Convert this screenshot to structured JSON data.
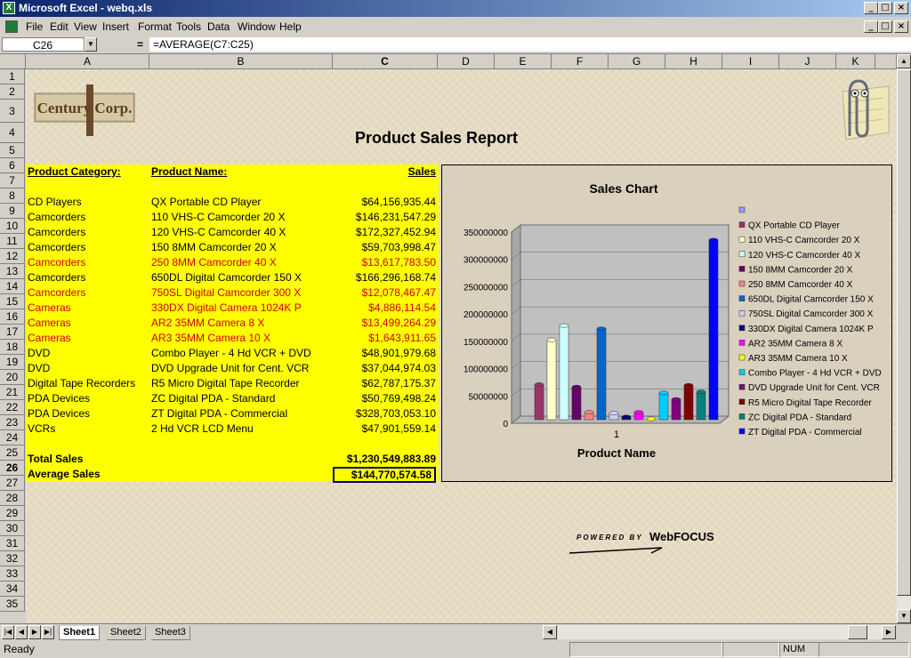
{
  "window": {
    "title": "Microsoft Excel - webq.xls",
    "app_icon": "excel-icon"
  },
  "menu": [
    "File",
    "Edit",
    "View",
    "Insert",
    "Format",
    "Tools",
    "Data",
    "Window",
    "Help"
  ],
  "formula_bar": {
    "name_box": "C26",
    "equals": "=",
    "formula": "=AVERAGE(C7:C25)"
  },
  "columns": [
    "A",
    "B",
    "C",
    "D",
    "E",
    "F",
    "G",
    "H",
    "I",
    "J",
    "K"
  ],
  "rows": [
    "1",
    "2",
    "3",
    "4",
    "5",
    "6",
    "7",
    "8",
    "9",
    "10",
    "11",
    "12",
    "13",
    "14",
    "15",
    "16",
    "17",
    "18",
    "19",
    "20",
    "21",
    "22",
    "23",
    "24",
    "25",
    "26",
    "27",
    "28",
    "29",
    "30",
    "31",
    "32",
    "33",
    "34",
    "35"
  ],
  "report": {
    "logo_text": "Century Corp.",
    "title": "Product Sales Report",
    "headers": {
      "category": "Product Category:",
      "name": "Product Name:",
      "sales": "Sales"
    },
    "items": [
      {
        "category": "CD Players",
        "name": "QX Portable CD Player",
        "sales": "$64,156,935.44",
        "red": false
      },
      {
        "category": "Camcorders",
        "name": "110 VHS-C Camcorder 20 X",
        "sales": "$146,231,547.29",
        "red": false
      },
      {
        "category": "Camcorders",
        "name": "120 VHS-C Camcorder 40 X",
        "sales": "$172,327,452.94",
        "red": false
      },
      {
        "category": "Camcorders",
        "name": "150 8MM Camcorder 20 X",
        "sales": "$59,703,998.47",
        "red": false
      },
      {
        "category": "Camcorders",
        "name": "250 8MM Camcorder 40 X",
        "sales": "$13,617,783.50",
        "red": true
      },
      {
        "category": "Camcorders",
        "name": "650DL Digital Camcorder 150 X",
        "sales": "$166,296,168.74",
        "red": false
      },
      {
        "category": "Camcorders",
        "name": "750SL Digital Camcorder 300 X",
        "sales": "$12,078,467.47",
        "red": true
      },
      {
        "category": "Cameras",
        "name": "330DX Digital Camera 1024K P",
        "sales": "$4,886,114.54",
        "red": true
      },
      {
        "category": "Cameras",
        "name": "AR2 35MM Camera 8 X",
        "sales": "$13,499,264.29",
        "red": true
      },
      {
        "category": "Cameras",
        "name": "AR3 35MM Camera 10 X",
        "sales": "$1,643,911.65",
        "red": true
      },
      {
        "category": "DVD",
        "name": "Combo Player - 4 Hd VCR + DVD",
        "sales": "$48,901,979.68",
        "red": false
      },
      {
        "category": "DVD",
        "name": "DVD Upgrade Unit for Cent. VCR",
        "sales": "$37,044,974.03",
        "red": false
      },
      {
        "category": "Digital Tape Recorders",
        "name": "R5 Micro Digital Tape Recorder",
        "sales": "$62,787,175.37",
        "red": false
      },
      {
        "category": "PDA Devices",
        "name": "ZC Digital PDA - Standard",
        "sales": "$50,769,498.24",
        "red": false
      },
      {
        "category": "PDA Devices",
        "name": "ZT Digital PDA - Commercial",
        "sales": "$328,703,053.10",
        "red": false
      },
      {
        "category": "VCRs",
        "name": "2 Hd VCR LCD Menu",
        "sales": "$47,901,559.14",
        "red": false
      }
    ],
    "total_label": "Total Sales",
    "total_value": "$1,230,549,883.89",
    "avg_label": "Average Sales",
    "avg_value": "$144,770,574.58",
    "powered_by": "POWERED BY",
    "powered_brand": "WebFOCUS"
  },
  "chart_data": {
    "type": "bar",
    "title": "Sales Chart",
    "xlabel": "Product Name",
    "categories": [
      "1"
    ],
    "ylim": [
      0,
      350000000
    ],
    "yticks": [
      "0",
      "50000000",
      "100000000",
      "150000000",
      "200000000",
      "250000000",
      "300000000",
      "350000000"
    ],
    "series": [
      {
        "name": "",
        "value": 0,
        "color": "#9999ff"
      },
      {
        "name": "QX Portable CD Player",
        "value": 64156935,
        "color": "#993366"
      },
      {
        "name": "110 VHS-C Camcorder 20 X",
        "value": 146231547,
        "color": "#ffffcc"
      },
      {
        "name": "120 VHS-C Camcorder 40 X",
        "value": 172327453,
        "color": "#ccffff"
      },
      {
        "name": "150 8MM Camcorder 20 X",
        "value": 59703998,
        "color": "#660066"
      },
      {
        "name": "250 8MM Camcorder 40 X",
        "value": 13617784,
        "color": "#ff8080"
      },
      {
        "name": "650DL Digital Camcorder 150 X",
        "value": 166296169,
        "color": "#0066cc"
      },
      {
        "name": "750SL Digital Camcorder 300 X",
        "value": 12078467,
        "color": "#ccccff"
      },
      {
        "name": "330DX Digital Camera 1024K P",
        "value": 4886115,
        "color": "#000080"
      },
      {
        "name": "AR2 35MM Camera 8 X",
        "value": 13499264,
        "color": "#ff00ff"
      },
      {
        "name": "AR3 35MM Camera 10 X",
        "value": 1643912,
        "color": "#ffff00"
      },
      {
        "name": "Combo Player - 4 Hd VCR + DVD",
        "value": 48901980,
        "color": "#00ccff"
      },
      {
        "name": "DVD Upgrade Unit for Cent. VCR",
        "value": 37044974,
        "color": "#800080"
      },
      {
        "name": "R5 Micro Digital Tape Recorder",
        "value": 62787175,
        "color": "#800000"
      },
      {
        "name": "ZC Digital PDA - Standard",
        "value": 50769498,
        "color": "#008080"
      },
      {
        "name": "ZT Digital PDA - Commercial",
        "value": 328703053,
        "color": "#0000ff"
      }
    ]
  },
  "sheet_tabs": [
    "Sheet1",
    "Sheet2",
    "Sheet3"
  ],
  "status": {
    "ready": "Ready",
    "num": "NUM"
  }
}
